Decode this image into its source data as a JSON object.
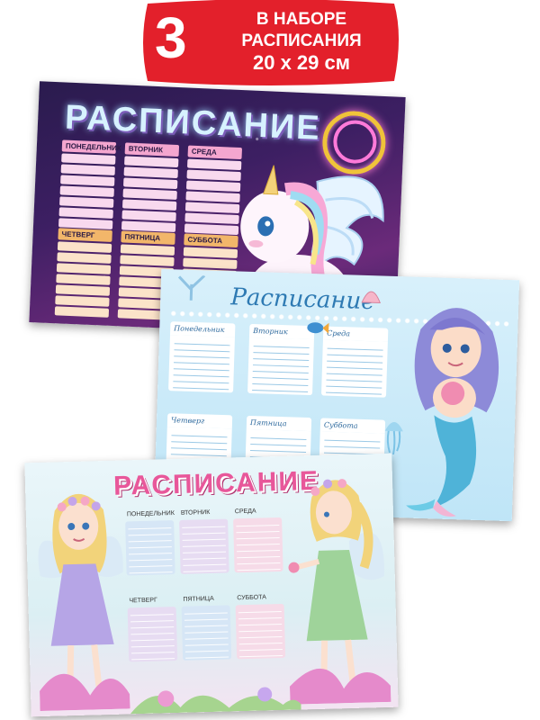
{
  "badge": {
    "count": "3",
    "line1": "В НАБОРЕ",
    "line2": "РАСПИСАНИЯ",
    "size": "20 х 29 см",
    "color": "#e3202b"
  },
  "cards": {
    "unicorn": {
      "title": "РАСПИСАНИЕ",
      "days": [
        "ПОНЕДЕЛЬНИК",
        "ВТОРНИК",
        "СРЕДА",
        "ЧЕТВЕРГ",
        "ПЯТНИЦА",
        "СУББОТА"
      ],
      "theme_color": "#3d1f63"
    },
    "mermaid": {
      "title": "Расписание",
      "days": [
        "Понедельник",
        "Вторник",
        "Среда",
        "Четверг",
        "Пятница",
        "Суббота"
      ],
      "theme_color": "#bfe5f7"
    },
    "fairy": {
      "title": "РАСПИСАНИЕ",
      "days": [
        "ПОНЕДЕЛЬНИК",
        "ВТОРНИК",
        "СРЕДА",
        "ЧЕТВЕРГ",
        "ПЯТНИЦА",
        "СУББОТА"
      ],
      "theme_color": "#e8579a"
    }
  }
}
